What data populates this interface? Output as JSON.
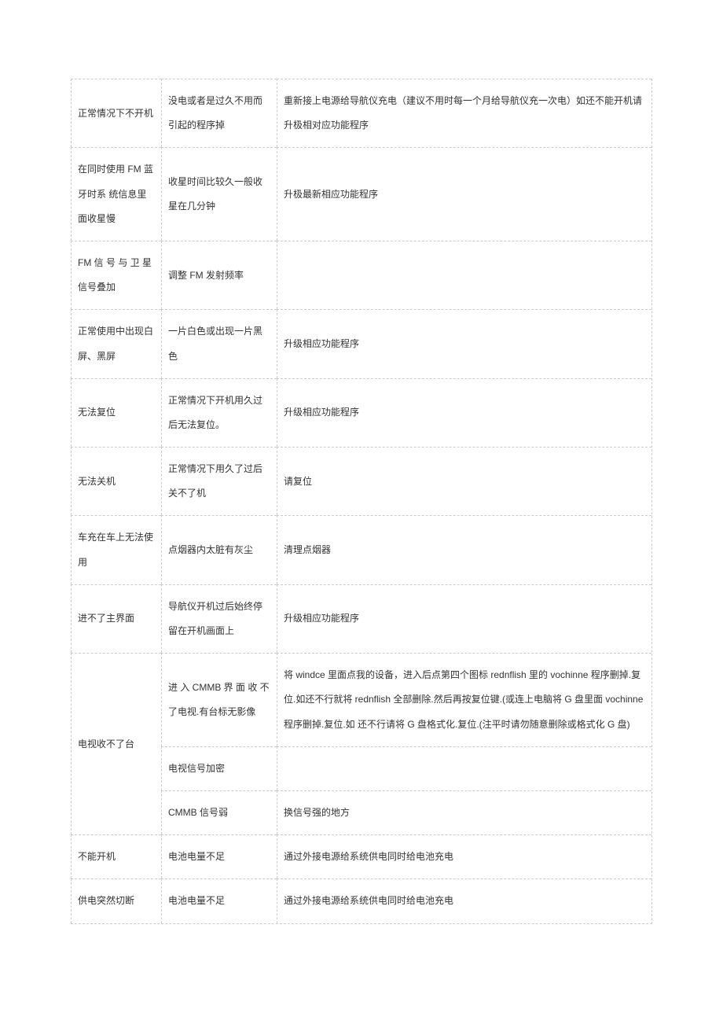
{
  "rows": [
    {
      "col1": "正常情况下不开机",
      "col2": "没电或者是过久不用而引起的程序掉",
      "col3": "重新接上电源给导航仪充电（建议不用时每一个月给导航仪充一次电）如还不能开机请升极相对应功能程序"
    },
    {
      "col1": "在同时使用 FM 蓝牙时系\n统信息里面收星慢",
      "col2": "收星时间比较久一般收星在几分钟",
      "col3": "升极最新相应功能程序"
    },
    {
      "col1": "FM 信 号 与 卫 星信号叠加",
      "col2": "调整 FM 发射频率",
      "col3": ""
    },
    {
      "col1": "正常使用中出现白屏、黑屏",
      "col2": "一片白色或出现一片黑色",
      "col3": "升级相应功能程序"
    },
    {
      "col1": "无法复位",
      "col2": "正常情况下开机用久过后无法复位。",
      "col3": "升级相应功能程序"
    },
    {
      "col1": "无法关机",
      "col2": "正常情况下用久了过后关不了机",
      "col3": "请复位"
    },
    {
      "col1": "车充在车上无法使用",
      "col2": "点烟器内太脏有灰尘",
      "col3": "清理点烟器"
    },
    {
      "col1": "进不了主界面",
      "col2": "导航仪开机过后始终停留在开机画面上",
      "col3": "升级相应功能程序"
    },
    {
      "col1": "电视收不了台",
      "col2a": "进 入 CMMB 界 面 收 不了电视.有台标无影像",
      "col3a": "将 windce 里面点我的设备，进入后点第四个图标 rednflish 里的 vochinne 程序删掉.复位.如还不行就将 rednflish 全部删除.然后再按复位键.(或连上电脑将 G 盘里面 vochinne 程序删掉.复位.如 还不行请将 G 盘格式化.复位.(注平时请勿随意删除或格式化 G 盘)",
      "col2b": "电视信号加密",
      "col3b": "",
      "col2c": "CMMB 信号弱",
      "col3c": "换信号强的地方"
    },
    {
      "col1": "不能开机",
      "col2": "电池电量不足",
      "col3": "通过外接电源给系统供电同时给电池充电"
    },
    {
      "col1": "供电突然切断",
      "col2": "电池电量不足",
      "col3": "通过外接电源给系统供电同时给电池充电"
    }
  ]
}
